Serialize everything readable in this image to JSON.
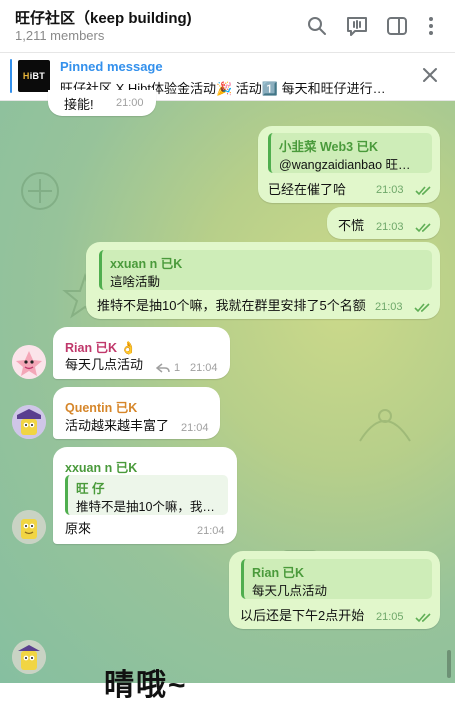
{
  "header": {
    "title": "旺仔社区（keep building)",
    "subtitle": "1,211 members",
    "icons": [
      "search-icon",
      "video-chat-icon",
      "side-panel-icon",
      "more-icon"
    ]
  },
  "pinned": {
    "title": "Pinned message",
    "thumb_label": "HiBT",
    "thumb_letter": "H",
    "text": "旺仔社区 X Hibt体验金活动🎉 活动1️⃣ 每天和旺仔进行…"
  },
  "messages": {
    "partial_top": {
      "text": "接能!",
      "time": "21:00"
    },
    "m1": {
      "quote_name": "小韭菜 Web3 已K",
      "quote_text": "@wangzaidianbao 旺…",
      "text": "已经在催了哈",
      "time": "21:03"
    },
    "m2": {
      "text": "不慌",
      "time": "21:03"
    },
    "m3": {
      "quote_name": "xxuan n 已K",
      "quote_text": "這啥活動",
      "text": "推特不是抽10个嘛，我就在群里安排了5个名额",
      "time": "21:03"
    },
    "m4": {
      "sender": "Rian 已K",
      "sender_emoji": "👌",
      "text": "每天几点活动",
      "reply_count": "1",
      "time": "21:04"
    },
    "m5": {
      "sender": "Quentin 已K",
      "text": "活动越来越丰富了",
      "time": "21:04"
    },
    "m6": {
      "sender": "xxuan n 已K",
      "quote_name": "旺 仔",
      "quote_text": "推特不是抽10个嘛，我…",
      "text": "原來",
      "time": "21:04"
    },
    "m7": {
      "quote_name": "Rian 已K",
      "quote_text": "每天几点活动",
      "text": "以后还是下午2点开始",
      "time": "21:05"
    },
    "partial_bottom": {
      "text": "晴哦~"
    }
  },
  "colors": {
    "accent": "#3390ec",
    "outgoing_bubble": "#e1f7cb",
    "incoming_bubble": "#ffffff",
    "rian_name": "#c0386b",
    "quentin_name": "#d6862a",
    "xxuan_name": "#4a9a3b"
  }
}
